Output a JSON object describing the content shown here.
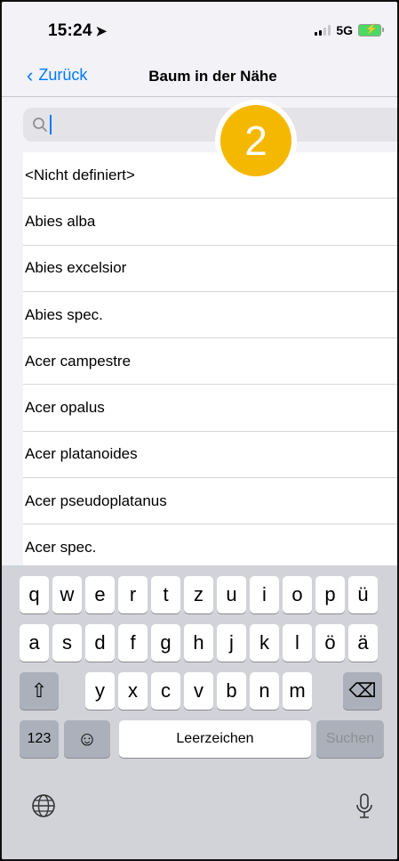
{
  "status": {
    "time": "15:24",
    "network": "5G"
  },
  "nav": {
    "back_label": "Zurück",
    "title": "Baum in der Nähe"
  },
  "search": {
    "value": "",
    "placeholder": ""
  },
  "badge": {
    "number": "2"
  },
  "list": {
    "items": [
      "<Nicht definiert>",
      "Abies alba",
      "Abies excelsior",
      "Abies spec.",
      "Acer campestre",
      "Acer opalus",
      "Acer platanoides",
      "Acer pseudoplatanus",
      "Acer spec."
    ]
  },
  "keyboard": {
    "row1": [
      "q",
      "w",
      "e",
      "r",
      "t",
      "z",
      "u",
      "i",
      "o",
      "p",
      "ü"
    ],
    "row2": [
      "a",
      "s",
      "d",
      "f",
      "g",
      "h",
      "j",
      "k",
      "l",
      "ö",
      "ä"
    ],
    "row3": [
      "y",
      "x",
      "c",
      "v",
      "b",
      "n",
      "m"
    ],
    "numbers_label": "123",
    "space_label": "Leerzeichen",
    "search_label": "Suchen"
  },
  "colors": {
    "accent": "#007aff",
    "badge": "#f5b800"
  }
}
